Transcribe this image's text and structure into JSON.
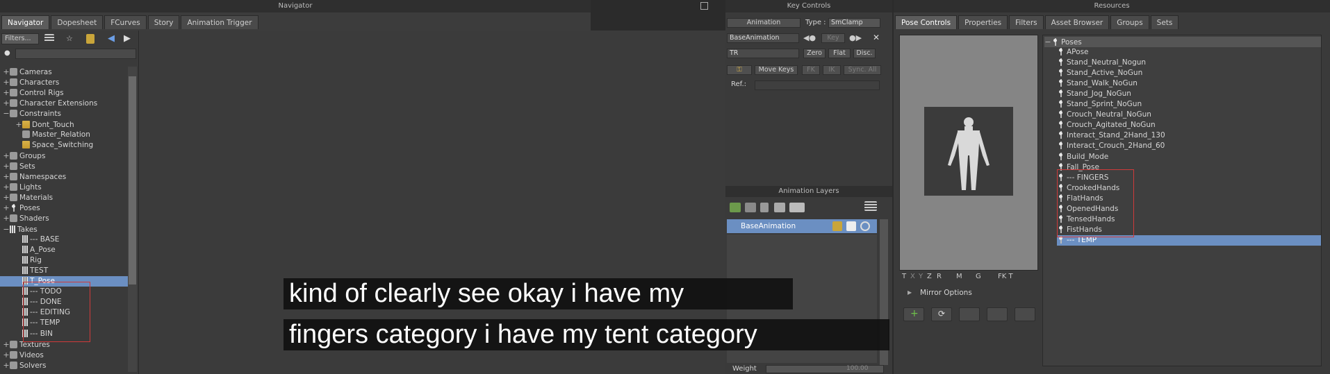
{
  "navigator": {
    "title": "Navigator",
    "tabs": [
      "Navigator",
      "Dopesheet",
      "FCurves",
      "Story",
      "Animation Trigger"
    ],
    "filters_label": "Filters...",
    "tree": [
      {
        "label": "Cameras",
        "depth": 0,
        "icon": "camera-icon"
      },
      {
        "label": "Characters",
        "depth": 0,
        "icon": "character-icon"
      },
      {
        "label": "Control Rigs",
        "depth": 0,
        "icon": "rig-icon"
      },
      {
        "label": "Character Extensions",
        "depth": 0,
        "icon": "extension-icon"
      },
      {
        "label": "Constraints",
        "depth": 0,
        "icon": "constraint-icon"
      },
      {
        "label": "Dont_Touch",
        "depth": 1,
        "icon": "folder-icon"
      },
      {
        "label": "Master_Relation",
        "depth": 1,
        "icon": "relation-icon"
      },
      {
        "label": "Space_Switching",
        "depth": 1,
        "icon": "folder-icon"
      },
      {
        "label": "Groups",
        "depth": 0,
        "icon": "group-icon"
      },
      {
        "label": "Sets",
        "depth": 0,
        "icon": "set-icon"
      },
      {
        "label": "Namespaces",
        "depth": 0,
        "icon": "namespace-icon"
      },
      {
        "label": "Lights",
        "depth": 0,
        "icon": "light-icon"
      },
      {
        "label": "Materials",
        "depth": 0,
        "icon": "material-icon"
      },
      {
        "label": "Poses",
        "depth": 0,
        "icon": "pose-icon"
      },
      {
        "label": "Shaders",
        "depth": 0,
        "icon": "shader-icon"
      },
      {
        "label": "Takes",
        "depth": 0,
        "icon": "take-icon"
      },
      {
        "label": "--- BASE",
        "depth": 1,
        "icon": "take-icon"
      },
      {
        "label": "A_Pose",
        "depth": 1,
        "icon": "take-icon"
      },
      {
        "label": "Rig",
        "depth": 1,
        "icon": "take-icon"
      },
      {
        "label": "TEST",
        "depth": 1,
        "icon": "take-icon"
      },
      {
        "label": "T_Pose",
        "depth": 1,
        "icon": "take-icon"
      },
      {
        "label": "--- TODO",
        "depth": 1,
        "icon": "take-icon"
      },
      {
        "label": "--- DONE",
        "depth": 1,
        "icon": "take-icon"
      },
      {
        "label": "--- EDITING",
        "depth": 1,
        "icon": "take-icon"
      },
      {
        "label": "--- TEMP",
        "depth": 1,
        "icon": "take-icon"
      },
      {
        "label": "--- BIN",
        "depth": 1,
        "icon": "take-icon"
      },
      {
        "label": "Textures",
        "depth": 0,
        "icon": "texture-icon"
      },
      {
        "label": "Videos",
        "depth": 0,
        "icon": "video-icon"
      },
      {
        "label": "Solvers",
        "depth": 0,
        "icon": "solver-icon"
      }
    ]
  },
  "key_controls": {
    "title": "Key Controls",
    "animation_btn": "Animation",
    "type_label": "Type :",
    "type_value": "SmClamp",
    "layer_value": "BaseAnimation",
    "key_label": "Key",
    "tr_value": "TR",
    "zero": "Zero",
    "flat": "Flat",
    "disc": "Disc.",
    "move_keys": "Move Keys",
    "fk": "FK",
    "ik": "IK",
    "sync_all": "Sync. All",
    "ref_label": "Ref.:"
  },
  "anim_layers": {
    "title": "Animation Layers",
    "layer_name": "BaseAnimation",
    "weight_label": "Weight",
    "weight_value": "100.00"
  },
  "resources": {
    "title": "Resources",
    "tabs": [
      "Pose Controls",
      "Properties",
      "Filters",
      "Asset Browser",
      "Groups",
      "Sets"
    ],
    "tree_root": "Poses",
    "poses": [
      "APose",
      "Stand_Neutral_Nogun",
      "Stand_Active_NoGun",
      "Stand_Walk_NoGun",
      "Stand_Jog_NoGun",
      "Stand_Sprint_NoGun",
      "Crouch_Neutral_NoGun",
      "Crouch_Agitated_NoGun",
      "Interact_Stand_2Hand_130",
      "Interact_Crouch_2Hand_60",
      "Build_Mode",
      "Fall_Pose",
      "--- FINGERS",
      "CrookedHands",
      "FlatHands",
      "OpenedHands",
      "TensedHands",
      "FistHands",
      "--- TEMP"
    ],
    "axis_buttons": [
      "T",
      "X",
      "Y",
      "Z",
      "R",
      "M",
      "G",
      "FK T"
    ],
    "mirror_options": "Mirror Options"
  },
  "caption": {
    "line1": "kind of clearly see okay i have my",
    "line2": "fingers category i have my tent category"
  }
}
